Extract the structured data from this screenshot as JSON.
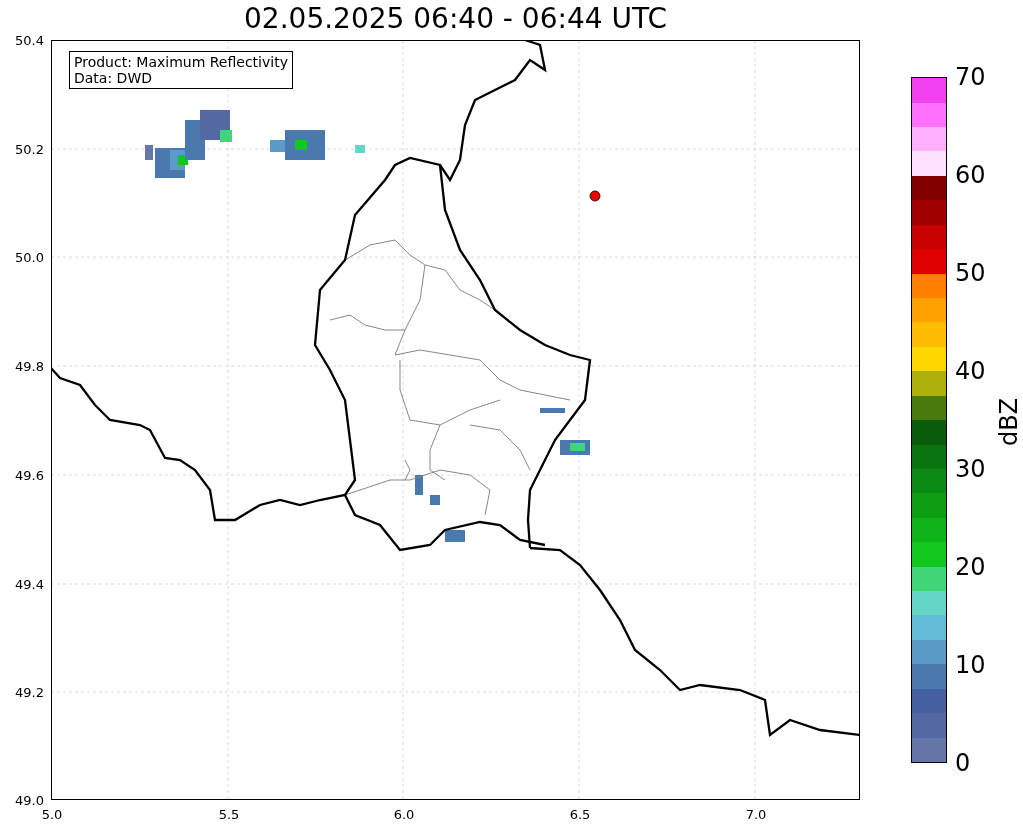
{
  "title": "02.05.2025 06:40 - 06:44 UTC",
  "info_box": [
    "Product: Maximum Reflectivity",
    "Data: DWD"
  ],
  "x_ticks": [
    "5.0",
    "5.5",
    "6.0",
    "6.5",
    "7.0"
  ],
  "y_ticks": [
    "50.4",
    "50.2",
    "50.0",
    "49.8",
    "49.6",
    "49.4",
    "49.2",
    "49.0"
  ],
  "colorbar": {
    "label": "dBZ",
    "ticks": [
      "70",
      "60",
      "50",
      "40",
      "30",
      "20",
      "10",
      "0"
    ],
    "segments": [
      {
        "color": "#6477a6"
      },
      {
        "color": "#5469a3"
      },
      {
        "color": "#4560a0"
      },
      {
        "color": "#4a79b0"
      },
      {
        "color": "#5a9bc8"
      },
      {
        "color": "#63bcd8"
      },
      {
        "color": "#63d6c8"
      },
      {
        "color": "#3ed677"
      },
      {
        "color": "#12c81f"
      },
      {
        "color": "#10b418"
      },
      {
        "color": "#0e9e14"
      },
      {
        "color": "#0c8a12"
      },
      {
        "color": "#0a7410"
      },
      {
        "color": "#0a5c0c"
      },
      {
        "color": "#4a7a0c"
      },
      {
        "color": "#b0b00a"
      },
      {
        "color": "#ffd700"
      },
      {
        "color": "#ffbc00"
      },
      {
        "color": "#ffa000"
      },
      {
        "color": "#ff8000"
      },
      {
        "color": "#e00000"
      },
      {
        "color": "#c80000"
      },
      {
        "color": "#a00000"
      },
      {
        "color": "#800000"
      },
      {
        "color": "#ffe0ff"
      },
      {
        "color": "#ffb0ff"
      },
      {
        "color": "#ff70ff"
      },
      {
        "color": "#f040f0"
      }
    ]
  }
}
